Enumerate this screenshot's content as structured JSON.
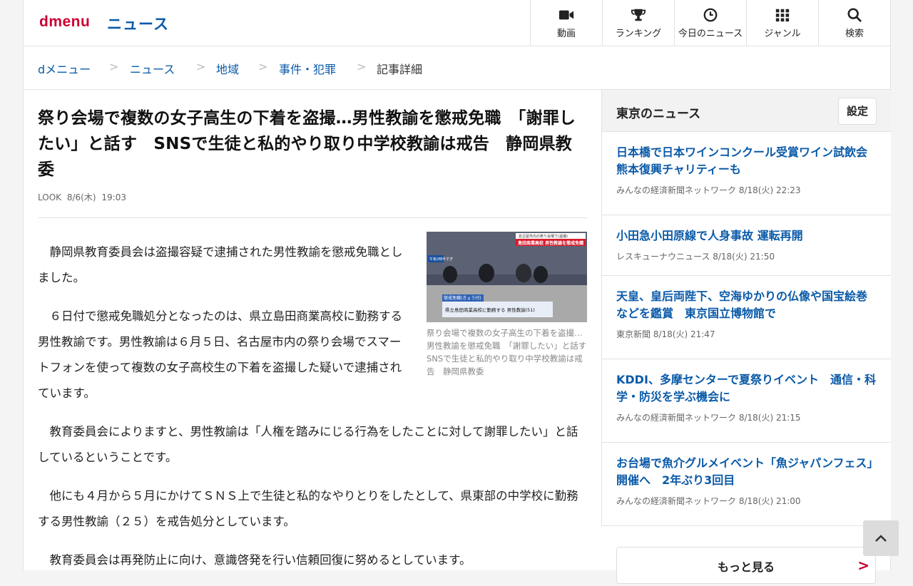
{
  "header": {
    "logo": "dmenu",
    "section": "ニュース",
    "nav": [
      {
        "label": "動画",
        "icon": "video-camera-icon"
      },
      {
        "label": "ランキング",
        "icon": "trophy-icon"
      },
      {
        "label": "今日のニュース",
        "icon": "clock-icon"
      },
      {
        "label": "ジャンル",
        "icon": "grid-icon"
      },
      {
        "label": "検索",
        "icon": "search-icon"
      }
    ]
  },
  "breadcrumb": [
    "dメニュー",
    "ニュース",
    "地域",
    "事件・犯罪",
    "記事詳細"
  ],
  "article": {
    "title": "祭り会場で複数の女子高生の下着を盗撮…男性教諭を懲戒免職　「謝罪したい」と話す　SNSで生徒と私的やり取り中学校教諭は戒告　静岡県教委",
    "source": "LOOK",
    "date": "8/6(木)",
    "time": "19:03",
    "image_caption": "祭り会場で複数の女子高生の下着を盗撮…男性教諭を懲戒免職　「謝罪したい」と話す　SNSで生徒と私的やり取り中学校教諭は戒告　静岡県教委",
    "image_overlay": {
      "top_label": "名古屋市内の祭り会場で(盗撮)",
      "top_main": "島田商業高校 男性教諭を懲戒免職",
      "badge": "懲戒免職(きょう付)",
      "lower": "県立島田商業高校に勤務する 男性教諭(51)",
      "time": "午後2時半すぎ"
    },
    "paragraphs": [
      "静岡県教育委員会は盗撮容疑で逮捕された男性教諭を懲戒免職としました。",
      "６日付で懲戒免職処分となったのは、県立島田商業高校に勤務する男性教諭です。男性教諭は６月５日、名古屋市内の祭り会場でスマートフォンを使って複数の女子高校生の下着を盗撮した疑いで逮捕されています。",
      "教育委員会によりますと、男性教諭は「人権を踏みにじる行為をしたことに対して謝罪したい」と話しているということです。",
      "他にも４月から５月にかけてＳＮＳ上で生徒と私的なやりとりをしたとして、県東部の中学校に勤務する男性教諭（２５）を戒告処分としています。",
      "教育委員会は再発防止に向け、意識啓発を行い信頼回復に努めるとしています。"
    ]
  },
  "sidebar": {
    "title": "東京のニュース",
    "settings_label": "設定",
    "items": [
      {
        "headline": "日本橋で日本ワインコンクール受賞ワイン試飲会　熊本復興チャリティーも",
        "source": "みんなの経済新聞ネットワーク",
        "date": "8/18(火)",
        "time": "22:23"
      },
      {
        "headline": "小田急小田原線で人身事故 運転再開",
        "source": "レスキューナウニュース",
        "date": "8/18(火)",
        "time": "21:50"
      },
      {
        "headline": "天皇、皇后両陛下、空海ゆかりの仏像や国宝絵巻などを鑑賞　東京国立博物館で",
        "source": "東京新聞",
        "date": "8/18(火)",
        "time": "21:47"
      },
      {
        "headline": "KDDI、多摩センターで夏祭りイベント　通信・科学・防災を学ぶ機会に",
        "source": "みんなの経済新聞ネットワーク",
        "date": "8/18(火)",
        "time": "21:15"
      },
      {
        "headline": "お台場で魚介グルメイベント「魚ジャパンフェス」開催へ　2年ぶり3回目",
        "source": "みんなの経済新聞ネットワーク",
        "date": "8/18(火)",
        "time": "21:00"
      }
    ],
    "more_label": "もっと見る"
  }
}
